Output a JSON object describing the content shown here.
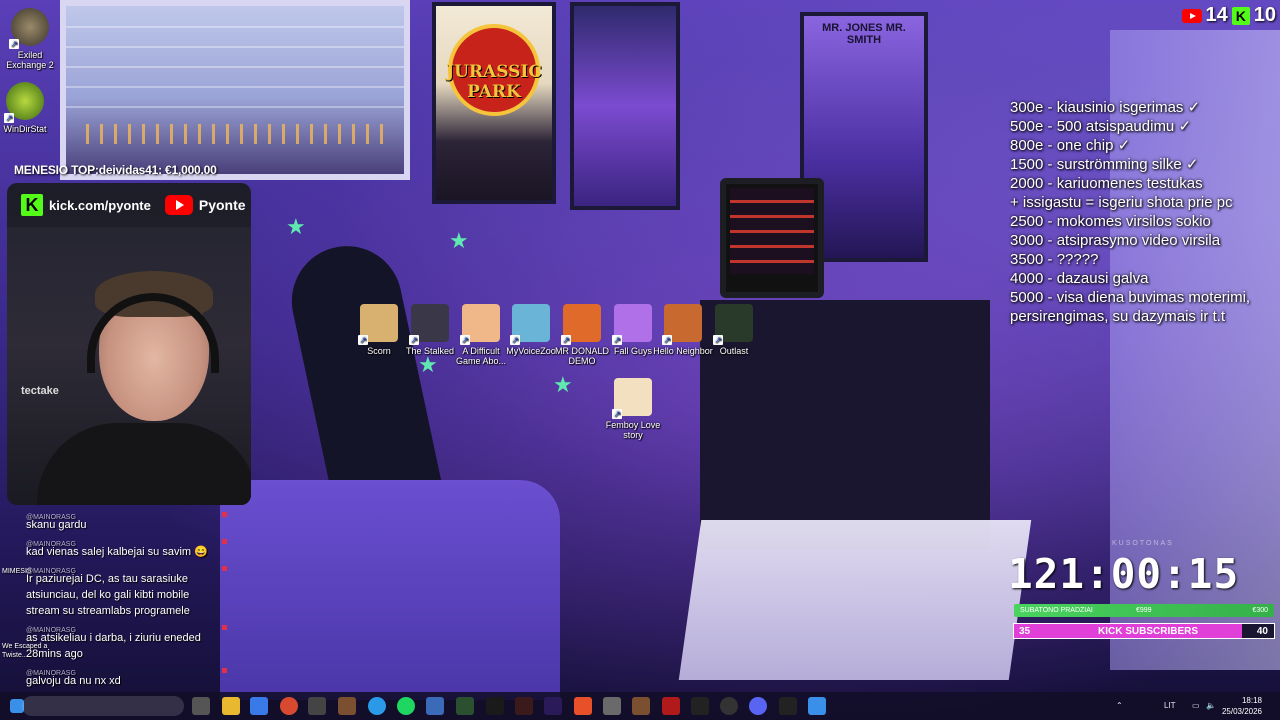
{
  "desktop_icons_left": [
    {
      "name": "Exiled Exchange 2"
    },
    {
      "name": "WinDirStat"
    }
  ],
  "desktop_icons_center": [
    {
      "name": "Scorn",
      "color": "#d8b070"
    },
    {
      "name": "The Stalked",
      "color": "#3a3848"
    },
    {
      "name": "A Difficult Game Abo...",
      "color": "#f0b888"
    },
    {
      "name": "MyVoiceZoo",
      "color": "#6ab4d8"
    },
    {
      "name": "MR DONALD DEMO",
      "color": "#e06a2a"
    },
    {
      "name": "Fall Guys",
      "color": "#b070e8"
    },
    {
      "name": "Hello Neighbor",
      "color": "#c86a30"
    },
    {
      "name": "Outlast",
      "color": "#2a3a2a"
    },
    {
      "name": "Femboy Love story",
      "color": "#f3e0c0"
    }
  ],
  "left_strip": {
    "mimesis": "MIMESIS",
    "we_escaped": "We Escaped a Twiste..."
  },
  "overlay": {
    "top_donor": "MENESIO TOP:deividas41: €1,000.00",
    "kick_logo": "K",
    "kick_url": "kick.com/pyonte",
    "yt_name": "Pyonte",
    "chair_brand": "tectake",
    "viewers": {
      "youtube": "14",
      "kick": "10",
      "kick_logo": "K"
    }
  },
  "chat": [
    {
      "user": "@MAINORASG",
      "text": "skanu gardu"
    },
    {
      "user": "@MAINORASG",
      "text": "kad vienas salej kalbejai su savim 😄"
    },
    {
      "user": "@MAINORASG",
      "text": "Ir paziurejai DC, as tau sarasiuke atsiunciau, del ko gali kibti mobile stream su streamlabs programele"
    },
    {
      "user": "@MAINORASG",
      "text": "as atsikeliau i darba, i ziuriu eneded 28mins ago"
    },
    {
      "user": "@MAINORASG",
      "text": "galvoju da nu nx xd"
    }
  ],
  "goals": [
    "300e - kiausinio isgerimas ✓",
    "500e - 500 atsispaudimu ✓",
    "800e - one chip ✓",
    "1500 - surströmming silke ✓",
    "2000 - kariuomenes testukas",
    "+ issigastu = isgeriu shota prie pc",
    "2500 - mokomes virsilos sokio",
    "3000 - atsiprasymo video virsila",
    "3500 - ?????",
    "4000 - dazausi galva",
    "5000 - visa diena buvimas moterimi,",
    "persirengimas, su dazymais ir t.t"
  ],
  "subathon": {
    "label_small": "KUSOTONAS",
    "timer": "121:00:15",
    "green_bar": {
      "left": "SUBATONO PRADZIAI",
      "mid": "€999",
      "right": "€300",
      "fill": 1.0
    },
    "kick_subs": {
      "count": "35",
      "label": "KICK SUBSCRIBERS",
      "goal": "40",
      "fill": 0.875
    }
  },
  "posters": {
    "jurassic": "JURASSIC PARK",
    "mib": "MR. JONES MR. SMITH"
  },
  "taskbar": {
    "language": "LIT",
    "time": "18:18",
    "date": "25/03/2026"
  },
  "colors": {
    "kick_green": "#53fc18",
    "youtube_red": "#ff0000",
    "kick_sub_pink": "#e03fd8",
    "green_bar": "#4ad35e"
  }
}
